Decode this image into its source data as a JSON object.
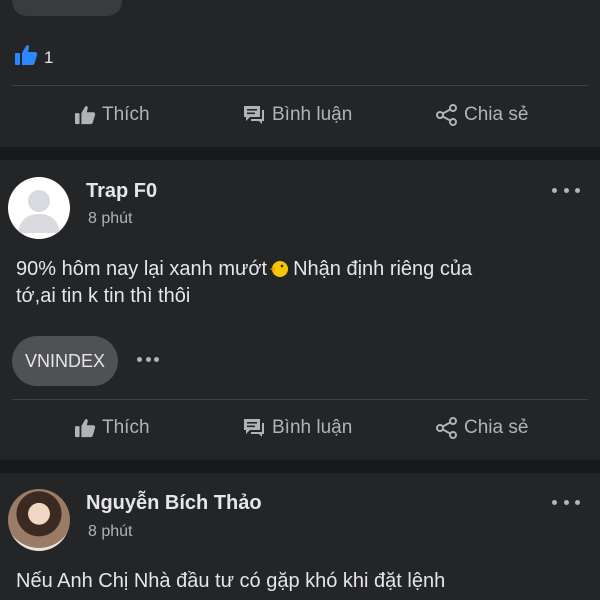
{
  "posts": [
    {
      "like_count": "1",
      "actions": {
        "like": "Thích",
        "comment": "Bình luận",
        "share": "Chia sẻ"
      }
    },
    {
      "author": "Trap F0",
      "time": "8 phút",
      "text_line1_before": "90% hôm nay lại xanh mướt",
      "text_line1_after": "Nhận định riêng của",
      "text_line2": "tớ,ai tin k tin thì thôi",
      "tag": "VNINDEX",
      "actions": {
        "like": "Thích",
        "comment": "Bình luận",
        "share": "Chia sẻ"
      }
    },
    {
      "author": "Nguyễn Bích Thảo",
      "time": "8 phút",
      "text_line1": "Nếu Anh Chị Nhà đầu tư có gặp khó khi đặt lệnh"
    }
  ],
  "colors": {
    "background": "#18191a",
    "card": "#242526",
    "text": "#e4e6eb",
    "secondary": "#b0b3b8",
    "like_blue": "#2d88ff",
    "tag_bg": "#505153"
  },
  "icons": [
    "thumbs-up-icon",
    "comment-icon",
    "share-icon",
    "more-icon",
    "emoji-icon",
    "avatar-icon"
  ]
}
